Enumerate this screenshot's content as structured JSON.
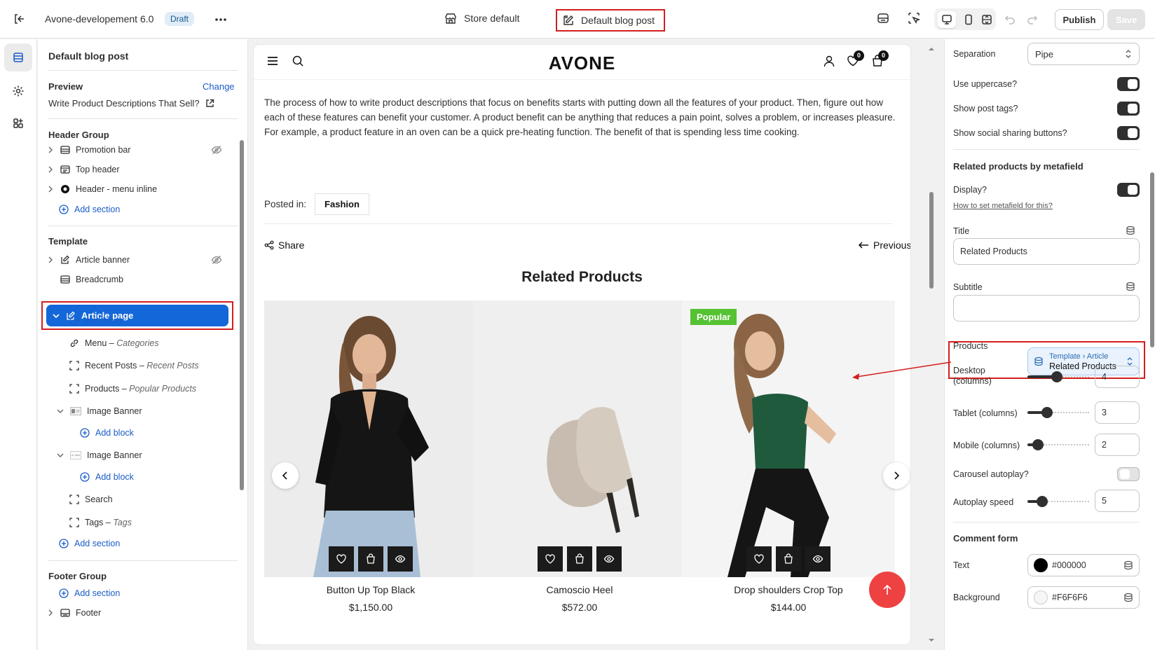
{
  "topbar": {
    "app_name": "Avone-developement 6.0",
    "status_badge": "Draft",
    "store_default": "Store default",
    "template_selector": "Default blog post",
    "publish_label": "Publish",
    "save_label": "Save"
  },
  "left_panel": {
    "title": "Default blog post",
    "preview_label": "Preview",
    "change_label": "Change",
    "preview_title": "Write Product Descriptions That Sell?",
    "header_group": {
      "label": "Header Group",
      "items": [
        "Promotion bar",
        "Top header",
        "Header - menu inline"
      ],
      "add_section": "Add section"
    },
    "template": {
      "label": "Template",
      "article_banner": "Article banner",
      "breadcrumb": "Breadcrumb",
      "article_page": "Article page",
      "add_block": "Add block",
      "blocks": [
        {
          "name": "Menu",
          "sub": "Categories"
        },
        {
          "name": "Recent Posts",
          "sub": "Recent Posts"
        },
        {
          "name": "Products",
          "sub": "Popular Products"
        }
      ],
      "image_banner_1": "Image Banner",
      "image_banner_2": "Image Banner",
      "search": "Search",
      "tags": {
        "name": "Tags",
        "sub": "Tags"
      },
      "add_section": "Add section"
    },
    "footer_group": {
      "label": "Footer Group",
      "add_section": "Add section",
      "footer": "Footer"
    }
  },
  "preview": {
    "logo": "AVONE",
    "wishlist_count": "0",
    "cart_count": "0",
    "body_text": "The process of how to write product descriptions that focus on benefits starts with putting down all the features of your product. Then, figure out how each of these features can benefit your customer. A product benefit can be anything that reduces a pain point, solves a problem, or increases pleasure. For example, a product feature in an oven can be a quick pre-heating function. The benefit of that is spending less time cooking.",
    "posted_in_label": "Posted in:",
    "posted_tag": "Fashion",
    "share_label": "Share",
    "previous_label": "Previous",
    "related_title": "Related Products",
    "products": [
      {
        "name": "Button Up Top Black",
        "price": "$1,150.00",
        "badge": ""
      },
      {
        "name": "Camoscio Heel",
        "price": "$572.00",
        "badge": ""
      },
      {
        "name": "Drop shoulders Crop Top",
        "price": "$144.00",
        "badge": "Popular"
      }
    ]
  },
  "settings": {
    "separation_label": "Separation",
    "separation_value": "Pipe",
    "use_uppercase_label": "Use uppercase?",
    "show_post_tags_label": "Show post tags?",
    "show_social_label": "Show social sharing buttons?",
    "related_section": "Related products by metafield",
    "display_label": "Display?",
    "metafield_help": "How to set metafield for this?",
    "title_label": "Title",
    "title_value": "Related Products",
    "subtitle_label": "Subtitle",
    "subtitle_value": "",
    "products_label": "Products",
    "products_source_path": "Template › Article",
    "products_source_value": "Related Products",
    "desktop_columns_label": "Desktop (columns)",
    "desktop_columns": "4",
    "tablet_columns_label": "Tablet (columns)",
    "tablet_columns": "3",
    "mobile_columns_label": "Mobile (columns)",
    "mobile_columns": "2",
    "carousel_autoplay_label": "Carousel autoplay?",
    "autoplay_speed_label": "Autoplay speed",
    "autoplay_speed": "5",
    "comment_form_section": "Comment form",
    "text_color_label": "Text",
    "text_color": "#000000",
    "background_color_label": "Background",
    "background_color": "#F6F6F6",
    "toggles": {
      "use_uppercase": true,
      "show_post_tags": true,
      "show_social": true,
      "display": true,
      "carousel_autoplay": false
    },
    "slider_levels": {
      "desktop": 4,
      "tablet": 3,
      "mobile": 2,
      "autoplay_speed": 5
    }
  },
  "colors": {
    "accent_blue": "#1467d8",
    "annotation_red": "#d31e1e",
    "popular_badge": "#55c232",
    "scroll_top_button": "#ee4242"
  }
}
